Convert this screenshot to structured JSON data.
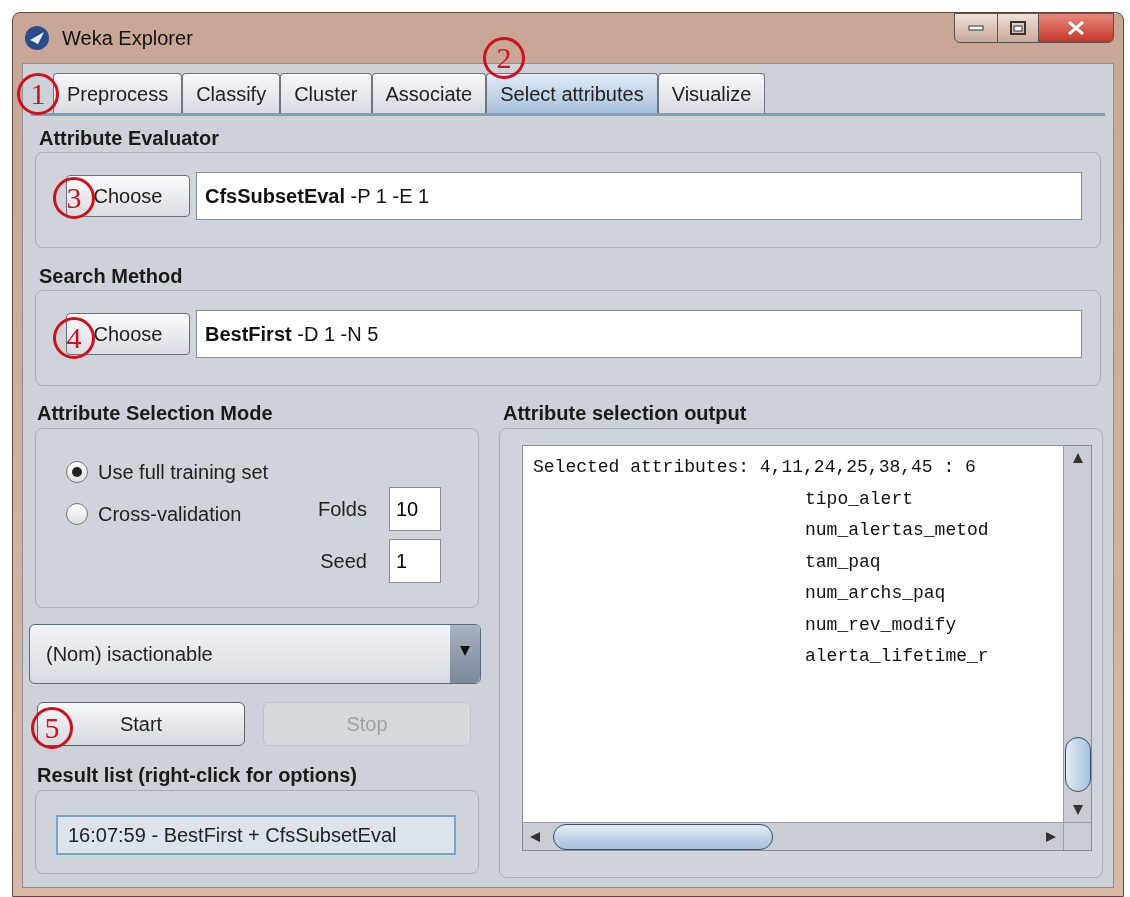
{
  "window": {
    "title": "Weka Explorer"
  },
  "tabs": [
    {
      "label": "Preprocess",
      "selected": false
    },
    {
      "label": "Classify",
      "selected": false
    },
    {
      "label": "Cluster",
      "selected": false
    },
    {
      "label": "Associate",
      "selected": false
    },
    {
      "label": "Select attributes",
      "selected": true
    },
    {
      "label": "Visualize",
      "selected": false
    }
  ],
  "attribute_evaluator": {
    "title": "Attribute Evaluator",
    "button": "Choose",
    "name": "CfsSubsetEval",
    "options": "-P 1 -E 1"
  },
  "search_method": {
    "title": "Search Method",
    "button": "Choose",
    "name": "BestFirst",
    "options": "-D 1 -N 5"
  },
  "selection_mode": {
    "title": "Attribute Selection Mode",
    "options": [
      {
        "label": "Use full training set",
        "selected": true
      },
      {
        "label": "Cross-validation",
        "selected": false
      }
    ],
    "folds": {
      "label": "Folds",
      "value": "10"
    },
    "seed": {
      "label": "Seed",
      "value": "1"
    }
  },
  "class_dropdown": {
    "value": "(Nom) isactionable"
  },
  "buttons": [
    {
      "label": "Start",
      "disabled": false
    },
    {
      "label": "Stop",
      "disabled": true
    }
  ],
  "result_list": {
    "title": "Result list (right-click for options)",
    "items": [
      {
        "label": "16:07:59 - BestFirst + CfsSubsetEval",
        "selected": true
      }
    ]
  },
  "output": {
    "title": "Attribute selection output",
    "header": "Selected attributes: 4,11,24,25,38,45 : 6",
    "attributes": [
      "tipo_alert",
      "num_alertas_metod",
      "tam_paq",
      "num_archs_paq",
      "num_rev_modify",
      "alerta_lifetime_r"
    ]
  },
  "annotations": [
    {
      "label": "1"
    },
    {
      "label": "2"
    },
    {
      "label": "3"
    },
    {
      "label": "4"
    },
    {
      "label": "5"
    }
  ]
}
